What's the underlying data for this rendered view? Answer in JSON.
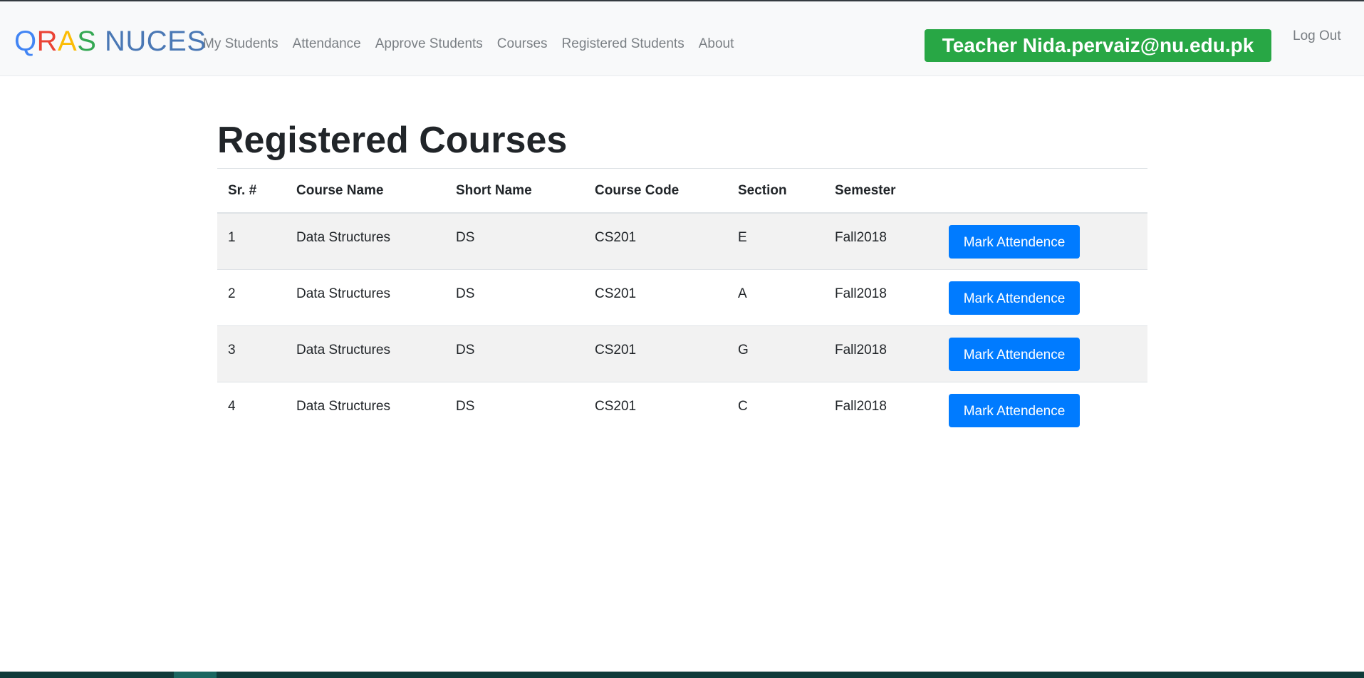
{
  "brand": {
    "letters": [
      {
        "char": "Q",
        "color": "#4285f4"
      },
      {
        "char": "R",
        "color": "#ea4335"
      },
      {
        "char": "A",
        "color": "#fbbc05"
      },
      {
        "char": "S",
        "color": "#34a853"
      },
      {
        "char": " ",
        "color": "#4a78b5"
      },
      {
        "char": "NUCES",
        "color": "#4a78b5"
      }
    ]
  },
  "nav": {
    "items": [
      {
        "label": "My Students"
      },
      {
        "label": "Attendance"
      },
      {
        "label": "Approve Students"
      },
      {
        "label": "Courses"
      },
      {
        "label": "Registered Students"
      },
      {
        "label": "About"
      }
    ],
    "teacher_badge": "Teacher Nida.pervaiz@nu.edu.pk",
    "logout": "Log Out"
  },
  "page": {
    "title": "Registered Courses"
  },
  "table": {
    "headers": [
      "Sr. #",
      "Course Name",
      "Short Name",
      "Course Code",
      "Section",
      "Semester",
      ""
    ],
    "rows": [
      {
        "sr": "1",
        "course_name": "Data Structures",
        "short_name": "DS",
        "course_code": "CS201",
        "section": "E",
        "semester": "Fall2018",
        "action": "Mark Attendence"
      },
      {
        "sr": "2",
        "course_name": "Data Structures",
        "short_name": "DS",
        "course_code": "CS201",
        "section": "A",
        "semester": "Fall2018",
        "action": "Mark Attendence"
      },
      {
        "sr": "3",
        "course_name": "Data Structures",
        "short_name": "DS",
        "course_code": "CS201",
        "section": "G",
        "semester": "Fall2018",
        "action": "Mark Attendence"
      },
      {
        "sr": "4",
        "course_name": "Data Structures",
        "short_name": "DS",
        "course_code": "CS201",
        "section": "C",
        "semester": "Fall2018",
        "action": "Mark Attendence"
      }
    ]
  },
  "colors": {
    "primary": "#007bff",
    "success": "#28a745",
    "navbar_bg": "#f8f9fa",
    "stripe": "#f2f2f2"
  }
}
